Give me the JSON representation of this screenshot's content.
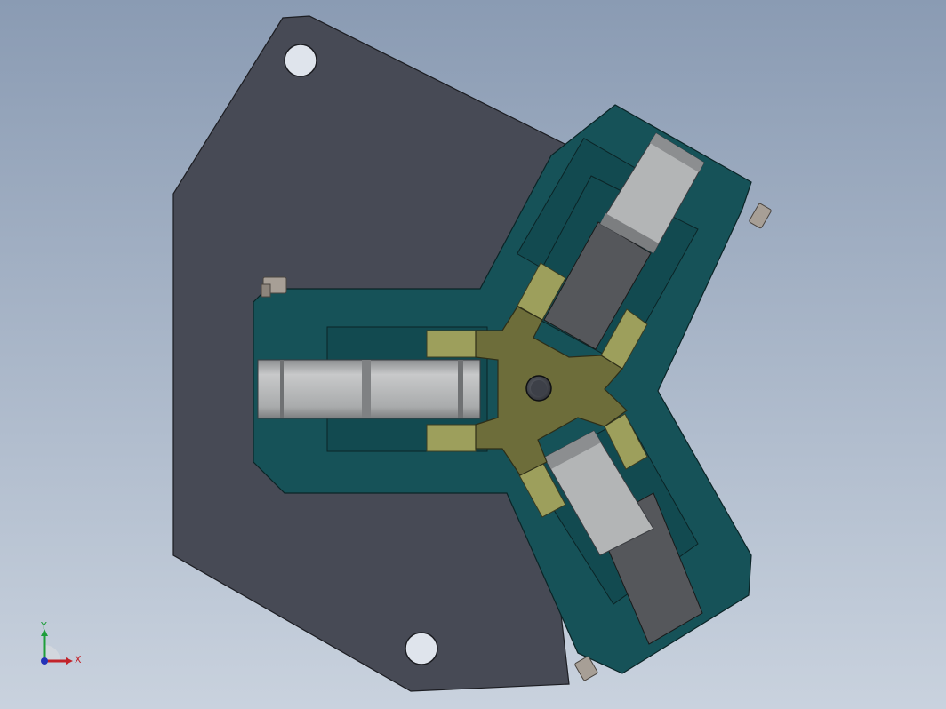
{
  "viewport": {
    "background_top": "#8a9bb3",
    "background_bottom": "#c9d2de"
  },
  "model": {
    "parts": [
      {
        "name": "base-plate",
        "color": "#474a55"
      },
      {
        "name": "y-slide-body",
        "color": "#165258"
      },
      {
        "name": "jaw-carriage",
        "color": "#2d2f33"
      },
      {
        "name": "spider-cam",
        "color": "#6d6d3a"
      },
      {
        "name": "link-pad",
        "color": "#9d9f5c"
      },
      {
        "name": "roller",
        "color": "#b3b5b6"
      },
      {
        "name": "screw-head",
        "color": "#a79f96"
      }
    ]
  },
  "triad": {
    "x_label": "X",
    "y_label": "Y",
    "x_color": "#c2232a",
    "y_color": "#1e9e3a",
    "z_color": "#2433b8"
  }
}
